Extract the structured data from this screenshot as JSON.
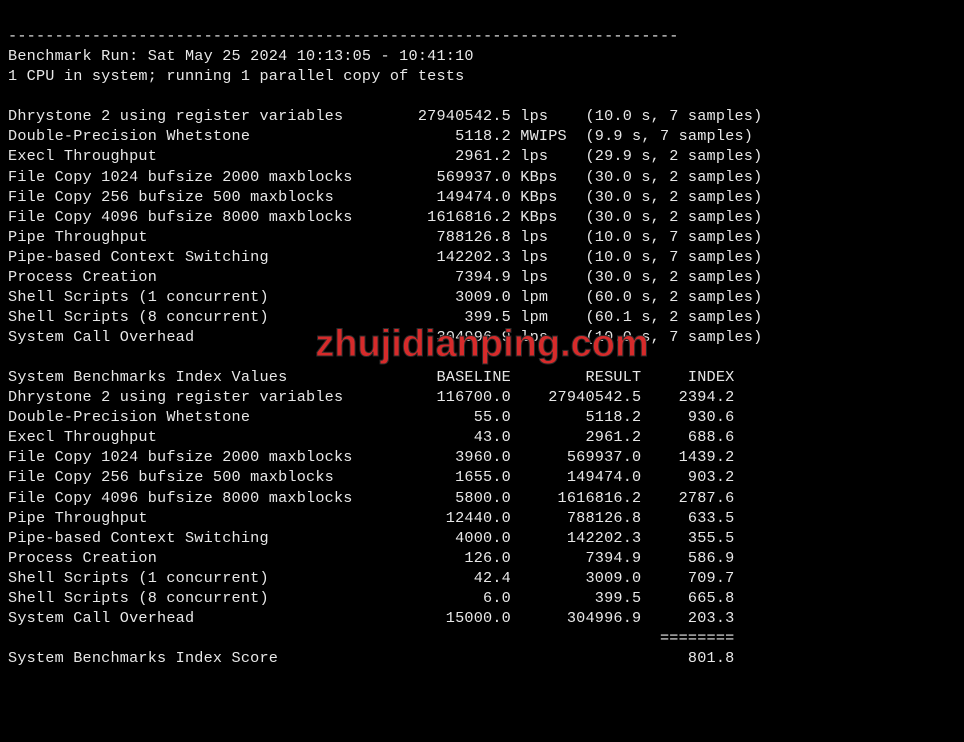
{
  "divider": "------------------------------------------------------------------------",
  "run_line": "Benchmark Run: Sat May 25 2024 10:13:05 - 10:41:10",
  "cpu_line": "1 CPU in system; running 1 parallel copy of tests",
  "raw_rows": [
    {
      "name": "Dhrystone 2 using register variables",
      "value": "27940542.5",
      "unit": "lps",
      "timing": "(10.0 s, 7 samples)"
    },
    {
      "name": "Double-Precision Whetstone",
      "value": "5118.2",
      "unit": "MWIPS",
      "timing": "(9.9 s, 7 samples)"
    },
    {
      "name": "Execl Throughput",
      "value": "2961.2",
      "unit": "lps",
      "timing": "(29.9 s, 2 samples)"
    },
    {
      "name": "File Copy 1024 bufsize 2000 maxblocks",
      "value": "569937.0",
      "unit": "KBps",
      "timing": "(30.0 s, 2 samples)"
    },
    {
      "name": "File Copy 256 bufsize 500 maxblocks",
      "value": "149474.0",
      "unit": "KBps",
      "timing": "(30.0 s, 2 samples)"
    },
    {
      "name": "File Copy 4096 bufsize 8000 maxblocks",
      "value": "1616816.2",
      "unit": "KBps",
      "timing": "(30.0 s, 2 samples)"
    },
    {
      "name": "Pipe Throughput",
      "value": "788126.8",
      "unit": "lps",
      "timing": "(10.0 s, 7 samples)"
    },
    {
      "name": "Pipe-based Context Switching",
      "value": "142202.3",
      "unit": "lps",
      "timing": "(10.0 s, 7 samples)"
    },
    {
      "name": "Process Creation",
      "value": "7394.9",
      "unit": "lps",
      "timing": "(30.0 s, 2 samples)"
    },
    {
      "name": "Shell Scripts (1 concurrent)",
      "value": "3009.0",
      "unit": "lpm",
      "timing": "(60.0 s, 2 samples)"
    },
    {
      "name": "Shell Scripts (8 concurrent)",
      "value": "399.5",
      "unit": "lpm",
      "timing": "(60.1 s, 2 samples)"
    },
    {
      "name": "System Call Overhead",
      "value": "304996.9",
      "unit": "lps",
      "timing": "(10.0 s, 7 samples)"
    }
  ],
  "index_header": {
    "title": "System Benchmarks Index Values",
    "baseline": "BASELINE",
    "result": "RESULT",
    "index": "INDEX"
  },
  "index_rows": [
    {
      "name": "Dhrystone 2 using register variables",
      "baseline": "116700.0",
      "result": "27940542.5",
      "index": "2394.2"
    },
    {
      "name": "Double-Precision Whetstone",
      "baseline": "55.0",
      "result": "5118.2",
      "index": "930.6"
    },
    {
      "name": "Execl Throughput",
      "baseline": "43.0",
      "result": "2961.2",
      "index": "688.6"
    },
    {
      "name": "File Copy 1024 bufsize 2000 maxblocks",
      "baseline": "3960.0",
      "result": "569937.0",
      "index": "1439.2"
    },
    {
      "name": "File Copy 256 bufsize 500 maxblocks",
      "baseline": "1655.0",
      "result": "149474.0",
      "index": "903.2"
    },
    {
      "name": "File Copy 4096 bufsize 8000 maxblocks",
      "baseline": "5800.0",
      "result": "1616816.2",
      "index": "2787.6"
    },
    {
      "name": "Pipe Throughput",
      "baseline": "12440.0",
      "result": "788126.8",
      "index": "633.5"
    },
    {
      "name": "Pipe-based Context Switching",
      "baseline": "4000.0",
      "result": "142202.3",
      "index": "355.5"
    },
    {
      "name": "Process Creation",
      "baseline": "126.0",
      "result": "7394.9",
      "index": "586.9"
    },
    {
      "name": "Shell Scripts (1 concurrent)",
      "baseline": "42.4",
      "result": "3009.0",
      "index": "709.7"
    },
    {
      "name": "Shell Scripts (8 concurrent)",
      "baseline": "6.0",
      "result": "399.5",
      "index": "665.8"
    },
    {
      "name": "System Call Overhead",
      "baseline": "15000.0",
      "result": "304996.9",
      "index": "203.3"
    }
  ],
  "score_underline": "========",
  "score_label": "System Benchmarks Index Score",
  "score_value": "801.8",
  "watermark": "zhujidianping.com"
}
